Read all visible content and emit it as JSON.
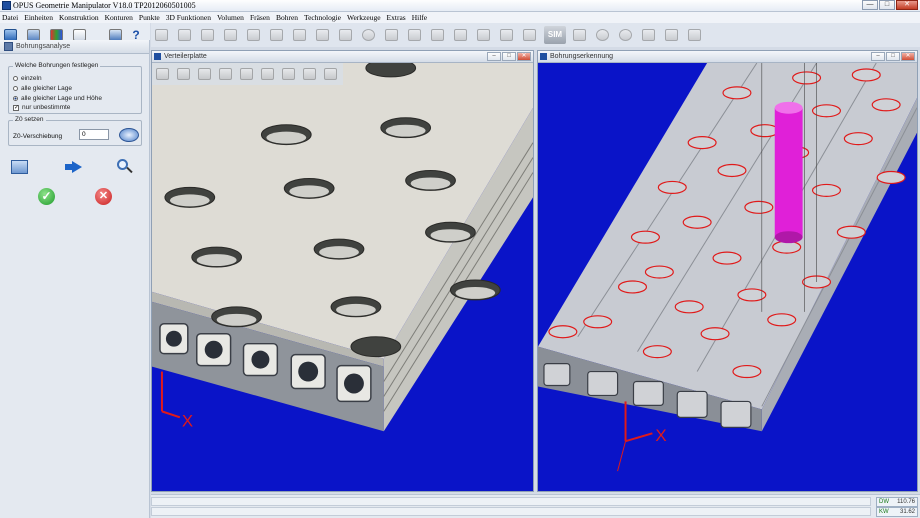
{
  "app": {
    "title": "OPUS Geometrie Manipulator V18.0   TP2012060501005",
    "window_buttons": {
      "minimize": "—",
      "maximize": "□",
      "close": "✕"
    }
  },
  "menu": [
    "Datei",
    "Einheiten",
    "Konstruktion",
    "Konturen",
    "Punkte",
    "3D Funktionen",
    "Volumen",
    "Fräsen",
    "Bohren",
    "Technologie",
    "Werkzeuge",
    "Extras",
    "Hilfe"
  ],
  "toolbar": {
    "sim_label": "SIM"
  },
  "left_panel": {
    "header": "Bohrungsanalyse",
    "group_bohrungen": {
      "title": "Welche Bohrungen festlegen",
      "options": [
        "einzeln",
        "alle gleicher Lage",
        "alle gleicher Lage und Höhe"
      ],
      "selected": 2,
      "checkbox_label": "nur unbestimmte",
      "checkbox_checked": true
    },
    "group_z0": {
      "title": "Z0 setzen",
      "field_label": "Z0-Verschiebung",
      "field_value": "0"
    }
  },
  "viewports": {
    "left": {
      "title": "Verteilerplatte",
      "axis_x": "X"
    },
    "right": {
      "title": "Bohrungserkennung",
      "axis_x": "X"
    }
  },
  "status": {
    "dw_label": "DW",
    "dw_value": "110.76",
    "kw_label": "KW",
    "kw_value": "31.62"
  },
  "colors": {
    "viewport_bg": "#0a14c8",
    "plate": "#dcdcd6",
    "highlight_cylinder": "#e020d8",
    "hole_outline_red": "#e01a1a"
  }
}
